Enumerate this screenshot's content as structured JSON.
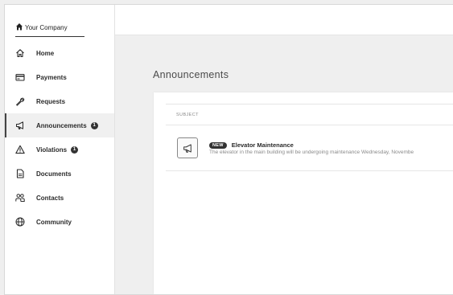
{
  "brand": {
    "company_name": "Your Company",
    "logo_icon": "house-icon"
  },
  "sidebar": {
    "items": [
      {
        "label": "Home",
        "icon": "home-icon"
      },
      {
        "label": "Payments",
        "icon": "card-icon"
      },
      {
        "label": "Requests",
        "icon": "wrench-icon"
      },
      {
        "label": "Announcements",
        "icon": "megaphone-icon",
        "badge": "1",
        "active": true
      },
      {
        "label": "Violations",
        "icon": "warning-icon",
        "badge": "1"
      },
      {
        "label": "Documents",
        "icon": "document-icon"
      },
      {
        "label": "Contacts",
        "icon": "people-icon"
      },
      {
        "label": "Community",
        "icon": "globe-icon"
      }
    ]
  },
  "main": {
    "title": "Announcements",
    "table": {
      "column_header": "SUBJECT",
      "rows": [
        {
          "tag": "NEW",
          "title": "Elevator Maintenance",
          "description": "The elevator in the main building will be undergoing maintenance Wednesday, Novembe",
          "icon": "megaphone-icon"
        }
      ]
    }
  },
  "colors": {
    "sidebar_bg": "#ffffff",
    "content_bg": "#efefef",
    "badge_bg": "#333333",
    "text_primary": "#2b2b2b",
    "text_muted": "#8a8a8a"
  }
}
